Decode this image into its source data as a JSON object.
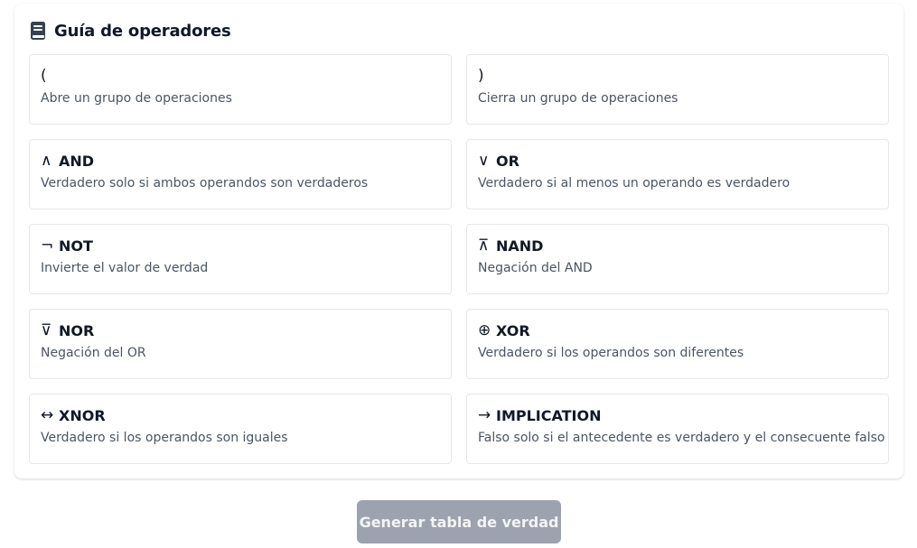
{
  "guide": {
    "icon": "book-icon",
    "title": "Guía de operadores"
  },
  "operators": [
    {
      "symbol": "(",
      "name": "",
      "description": "Abre un grupo de operaciones"
    },
    {
      "symbol": ")",
      "name": "",
      "description": "Cierra un grupo de operaciones"
    },
    {
      "symbol": "∧",
      "name": "AND",
      "description": "Verdadero solo si ambos operandos son verdaderos"
    },
    {
      "symbol": "∨",
      "name": "OR",
      "description": "Verdadero si al menos un operando es verdadero"
    },
    {
      "symbol": "¬",
      "name": "NOT",
      "description": "Invierte el valor de verdad"
    },
    {
      "symbol": "⊼",
      "name": "NAND",
      "description": "Negación del AND"
    },
    {
      "symbol": "⊽",
      "name": "NOR",
      "description": "Negación del OR"
    },
    {
      "symbol": "⊕",
      "name": "XOR",
      "description": "Verdadero si los operandos son diferentes"
    },
    {
      "symbol": "↔",
      "name": "XNOR",
      "description": "Verdadero si los operandos son iguales"
    },
    {
      "symbol": "→",
      "name": "IMPLICATION",
      "description": "Falso solo si el antecedente es verdadero y el consecuente falso"
    }
  ],
  "actions": {
    "generate_label": "Generar tabla de verdad",
    "generate_disabled": true
  },
  "colors": {
    "button_disabled_bg": "#9ca3af",
    "border": "#e5e7eb",
    "text_primary": "#111827",
    "text_secondary": "#4b5563"
  }
}
